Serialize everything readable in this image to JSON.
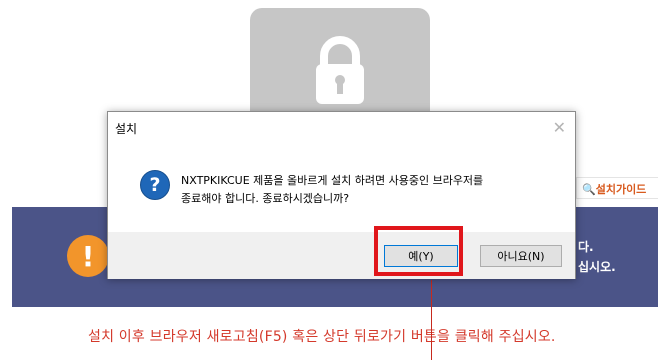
{
  "page": {
    "guide_label": "설치가이드",
    "banner_line1_tail": "다.",
    "banner_line2_tail": "십시오.",
    "bottom_message": "설치 이후 브라우저 새로고침(F5) 혹은 상단 뒤로가기 버튼을 클릭해 주십시오."
  },
  "dialog": {
    "title": "설치",
    "close_glyph": "✕",
    "icon": "question-icon",
    "message_line1": "NXTPKIKCUE 제품을 올바르게 설치 하려면 사용중인 브라우저를",
    "message_line2": "종료해야 합니다. 종료하시겠습니까?",
    "yes_label": "예(Y)",
    "no_label": "아니요(N)"
  },
  "colors": {
    "banner": "#4b5488",
    "warning_orange": "#f2952b",
    "alert_red": "#d43a2c",
    "highlight_red": "#e0161b",
    "question_blue": "#1f67b8"
  }
}
